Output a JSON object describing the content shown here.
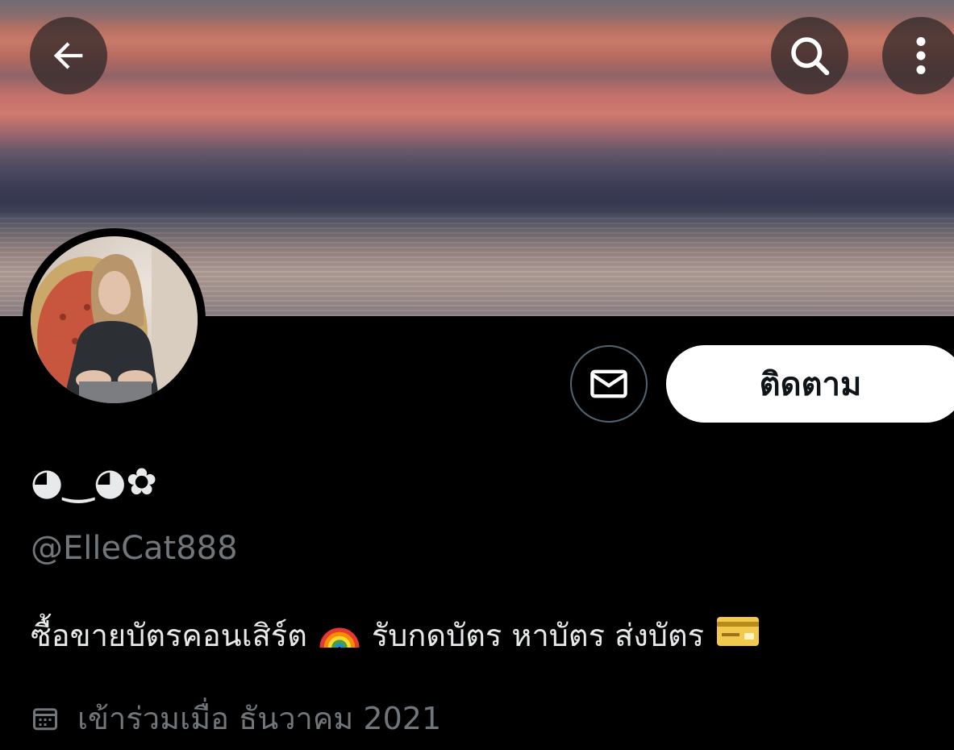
{
  "header": {
    "back_icon": "arrow-left-icon",
    "search_icon": "search-icon",
    "more_icon": "more-vertical-icon"
  },
  "profile": {
    "display_name": "◕‿◕✿",
    "handle": "@ElleCat888",
    "bio_part1": "ซื้อขายบัตรคอนเสิร์ต",
    "bio_part2": "รับกดบัตร หาบัตร ส่งบัตร",
    "joined_text": "เข้าร่วมเมื่อ ธันวาคม 2021"
  },
  "actions": {
    "follow_label": "ติดตาม",
    "message_icon": "envelope-icon"
  },
  "colors": {
    "background": "#000000",
    "text_primary": "#e7e9ea",
    "text_secondary": "#71767b",
    "button_bg": "#ffffff",
    "outline": "#536471"
  }
}
